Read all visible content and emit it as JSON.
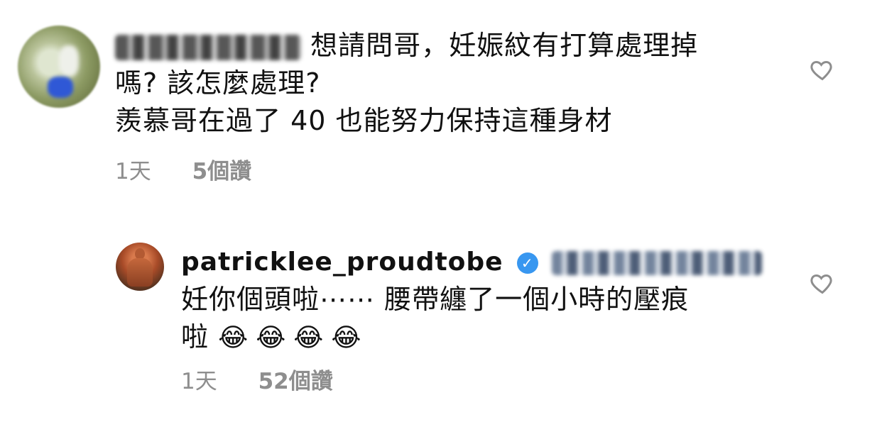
{
  "comments": [
    {
      "username": "",
      "text_line1": "想請問哥，妊娠紋有打算處理掉",
      "text_line2": "嗎? 該怎麼處理?",
      "text_line3": "羨慕哥在過了 40 也能努力保持這種身材",
      "time": "1天",
      "likes": "5個讚"
    },
    {
      "username": "patricklee_proudtobe",
      "verified": true,
      "text_line1": "妊你個頭啦⋯⋯ 腰帶纏了一個小時的壓痕",
      "text_line2": "啦",
      "emojis": [
        "😂",
        "😂",
        "😂",
        "😂"
      ],
      "time": "1天",
      "likes": "52個讚"
    }
  ],
  "icons": {
    "like": "heart-outline-icon",
    "verified": "verified-badge-icon"
  },
  "colors": {
    "meta_text": "#8e8e8e",
    "verified_blue": "#3897f0",
    "text": "#111111"
  }
}
